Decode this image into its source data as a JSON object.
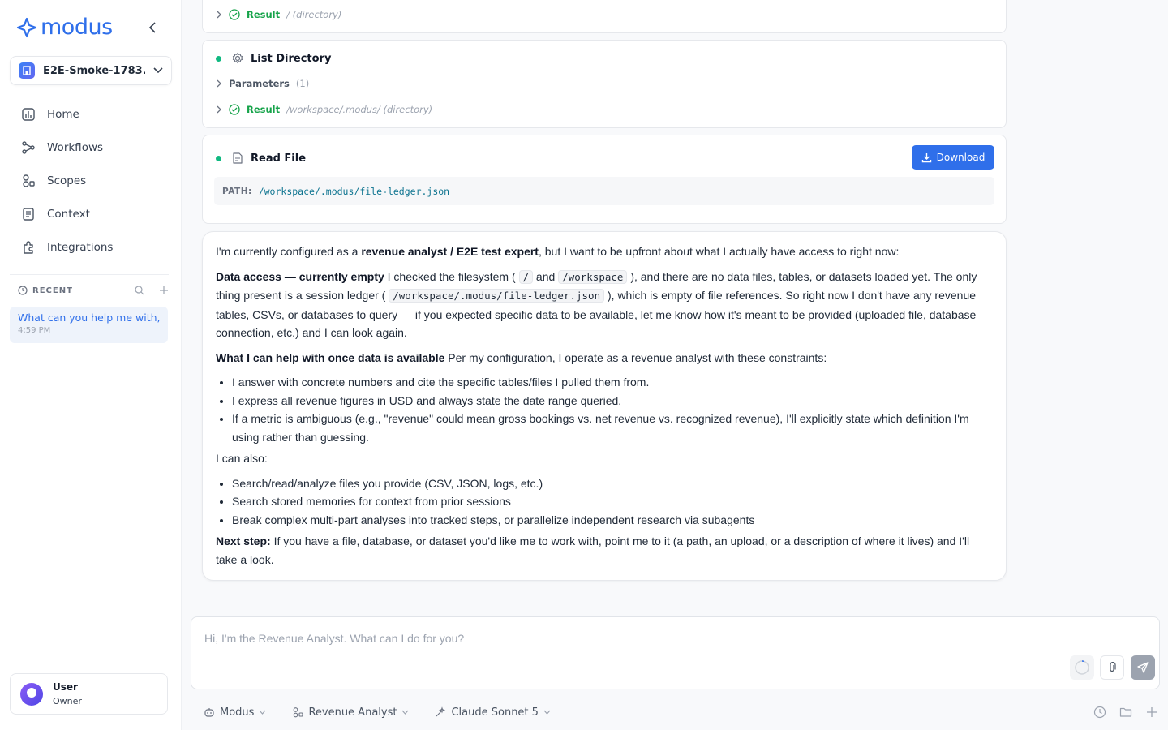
{
  "brand": {
    "name": "modus",
    "color": "#2f6fea"
  },
  "workspace": {
    "name": "E2E-Smoke-1783..."
  },
  "nav": [
    {
      "label": "Home",
      "icon": "home-icon"
    },
    {
      "label": "Workflows",
      "icon": "workflows-icon"
    },
    {
      "label": "Scopes",
      "icon": "scopes-icon"
    },
    {
      "label": "Context",
      "icon": "context-icon"
    },
    {
      "label": "Integrations",
      "icon": "integrations-icon"
    }
  ],
  "recent": {
    "title": "RECENT",
    "items": [
      {
        "title": "What can you help me with, ...",
        "time": "4:59 PM"
      }
    ]
  },
  "user": {
    "name": "User",
    "role": "Owner"
  },
  "tools": {
    "first_result": {
      "label": "Result",
      "meta": "/ (directory)"
    },
    "list_directory": {
      "title": "List Directory",
      "params_label": "Parameters",
      "params_count": "(1)",
      "result_label": "Result",
      "result_meta": "/workspace/.modus/ (directory)"
    },
    "read_file": {
      "title": "Read File",
      "download_label": "Download",
      "path_key": "PATH:",
      "path_value": "/workspace/.modus/file-ledger.json"
    }
  },
  "message": {
    "p1_pre": "I'm currently configured as a ",
    "p1_bold": "revenue analyst / E2E test expert",
    "p1_post": ", but I want to be upfront about what I actually have access to right now:",
    "p2_bold": "Data access — currently empty",
    "p2_a": " I checked the filesystem ( ",
    "p2_code1": "/",
    "p2_b": " and ",
    "p2_code2": "/workspace",
    "p2_c": " ), and there are no data files, tables, or datasets loaded yet. The only thing present is a session ledger ( ",
    "p2_code3": "/workspace/.modus/file-ledger.json",
    "p2_d": " ), which is empty of file references. So right now I don't have any revenue tables, CSVs, or databases to query — if you expected specific data to be available, let me know how it's meant to be provided (uploaded file, database connection, etc.) and I can look again.",
    "p3_bold": "What I can help with once data is available",
    "p3_post": " Per my configuration, I operate as a revenue analyst with these constraints:",
    "list1": [
      "I answer with concrete numbers and cite the specific tables/files I pulled them from.",
      "I express all revenue figures in USD and always state the date range queried.",
      "If a metric is ambiguous (e.g., \"revenue\" could mean gross bookings vs. net revenue vs. recognized revenue), I'll explicitly state which definition I'm using rather than guessing."
    ],
    "p4": "I can also:",
    "list2": [
      "Search/read/analyze files you provide (CSV, JSON, logs, etc.)",
      "Search stored memories for context from prior sessions",
      "Break complex multi-part analyses into tracked steps, or parallelize independent research via subagents"
    ],
    "p5_bold": "Next step:",
    "p5_post": " If you have a file, database, or dataset you'd like me to work with, point me to it (a path, an upload, or a description of where it lives) and I'll take a look."
  },
  "composer": {
    "placeholder": "Hi, I'm the Revenue Analyst. What can I do for you?",
    "agent": "Modus",
    "persona": "Revenue Analyst",
    "model": "Claude Sonnet 5"
  }
}
